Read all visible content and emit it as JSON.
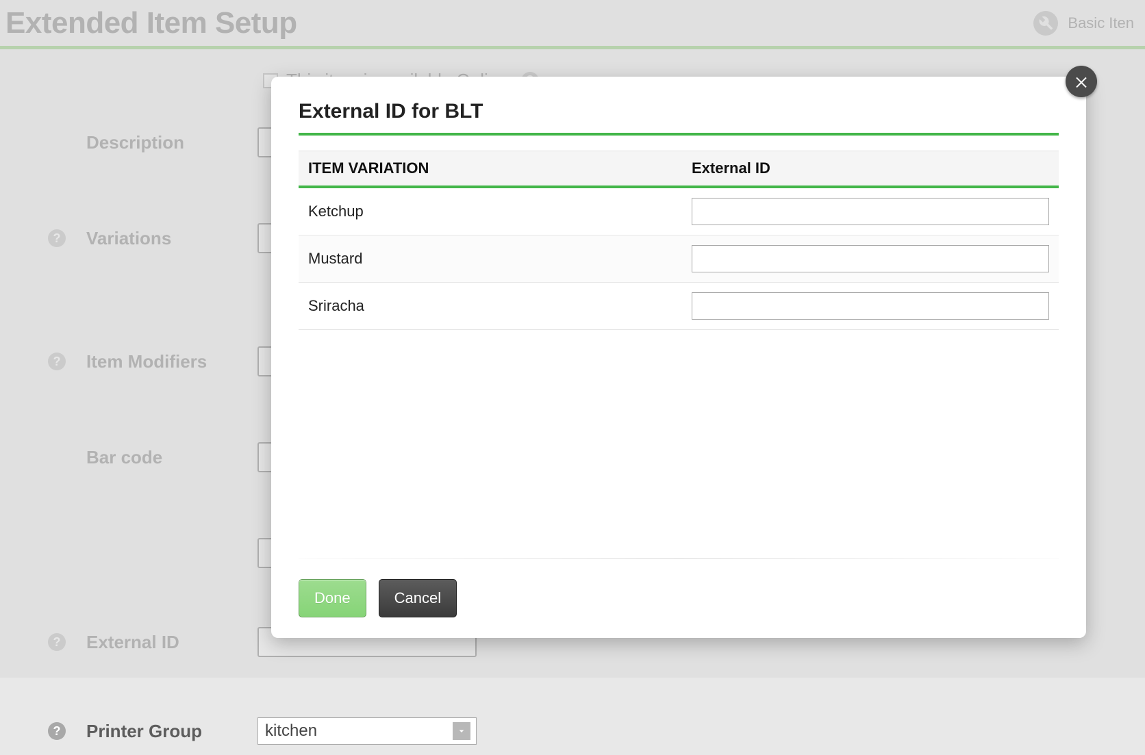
{
  "page": {
    "title": "Extended Item Setup",
    "header_link": "Basic Iten",
    "checkbox_label": "This item is available Online.",
    "fields": {
      "description": "Description",
      "variations": "Variations",
      "item_modifiers": "Item Modifiers",
      "bar_code": "Bar code",
      "external_id": "External ID",
      "printer_group": "Printer Group"
    },
    "printer_group_value": "kitchen"
  },
  "modal": {
    "title": "External ID for BLT",
    "columns": {
      "variation": "ITEM VARIATION",
      "external_id": "External ID"
    },
    "rows": [
      {
        "name": "Ketchup",
        "value": ""
      },
      {
        "name": "Mustard",
        "value": ""
      },
      {
        "name": "Sriracha",
        "value": ""
      }
    ],
    "buttons": {
      "done": "Done",
      "cancel": "Cancel"
    }
  }
}
